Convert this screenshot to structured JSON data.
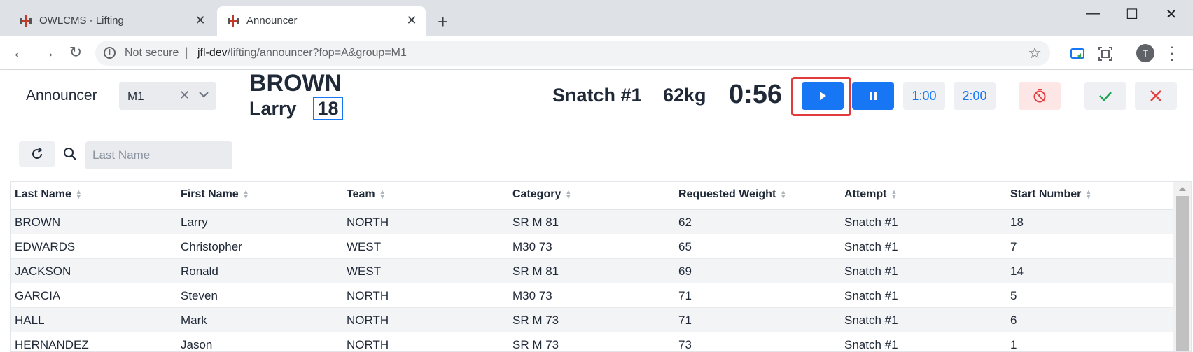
{
  "browser": {
    "tabs": [
      {
        "title": "OWLCMS - Lifting",
        "active": false
      },
      {
        "title": "Announcer",
        "active": true
      }
    ],
    "security": "Not secure",
    "url_host": "jfl-dev",
    "url_path": "/lifting/announcer?fop=A&group=M1",
    "profile_initial": "T"
  },
  "appbar": {
    "title": "Announcer",
    "group_value": "M1",
    "athlete_last": "BROWN",
    "athlete_first": "Larry",
    "start_number": "18",
    "attempt": "Snatch #1",
    "weight": "62kg",
    "timer": "0:56",
    "btn_1min": "1:00",
    "btn_2min": "2:00"
  },
  "filter": {
    "placeholder": "Last Name"
  },
  "table": {
    "headers": [
      "Last Name",
      "First Name",
      "Team",
      "Category",
      "Requested Weight",
      "Attempt",
      "Start Number"
    ],
    "rows": [
      [
        "BROWN",
        "Larry",
        "NORTH",
        "SR M 81",
        "62",
        "Snatch #1",
        "18"
      ],
      [
        "EDWARDS",
        "Christopher",
        "WEST",
        "M30 73",
        "65",
        "Snatch #1",
        "7"
      ],
      [
        "JACKSON",
        "Ronald",
        "WEST",
        "SR M 81",
        "69",
        "Snatch #1",
        "14"
      ],
      [
        "GARCIA",
        "Steven",
        "NORTH",
        "M30 73",
        "71",
        "Snatch #1",
        "5"
      ],
      [
        "HALL",
        "Mark",
        "NORTH",
        "SR M 73",
        "71",
        "Snatch #1",
        "6"
      ],
      [
        "HERNANDEZ",
        "Jason",
        "NORTH",
        "SR M 73",
        "73",
        "Snatch #1",
        "1"
      ]
    ]
  },
  "colors": {
    "accent": "#1676f3",
    "danger": "#e53e3e",
    "success": "#16a34a",
    "highlight": "#e03c3c"
  }
}
